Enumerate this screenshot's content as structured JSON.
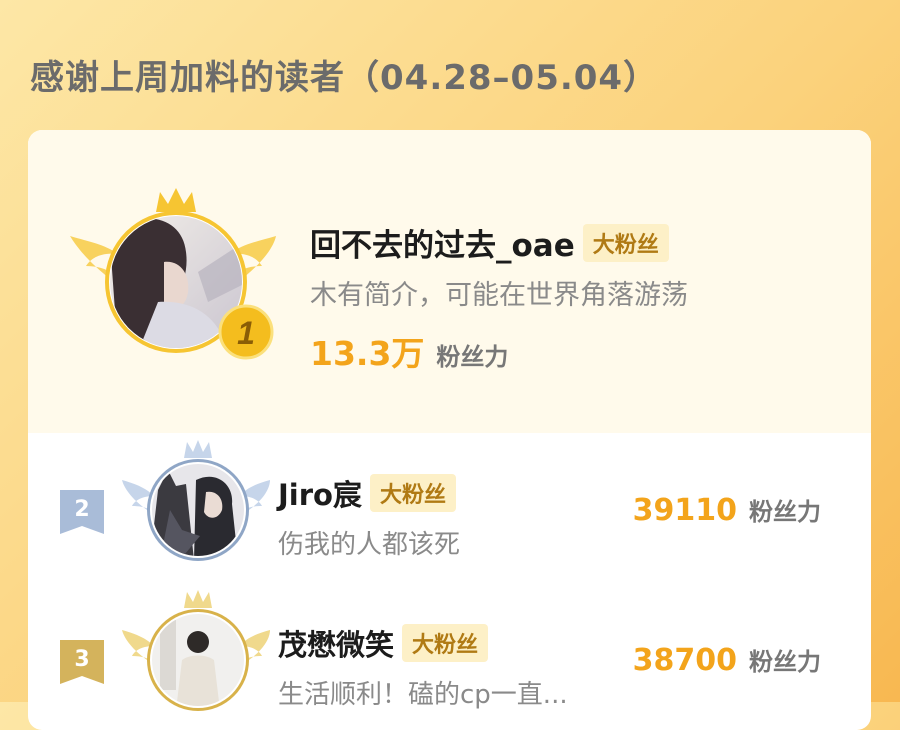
{
  "page": {
    "title": "感谢上周加料的读者（04.28–05.04）"
  },
  "fan_unit": "粉丝力",
  "ranking": [
    {
      "rank": "1",
      "name": "回不去的过去_oae",
      "tag": "大粉丝",
      "bio": "木有简介，可能在世界角落游荡",
      "fans": "13.3万",
      "frame_color": "#f6c532",
      "avatar_icon": "girl-portrait-avatar"
    },
    {
      "rank": "2",
      "name": "Jiro宸",
      "tag": "大粉丝",
      "bio": "伤我的人都该死",
      "fans": "39110",
      "frame_color": "#8fa6c6",
      "avatar_icon": "anime-pair-avatar"
    },
    {
      "rank": "3",
      "name": "茂懋微笑",
      "tag": "大粉丝",
      "bio": "生活顺利！磕的cp一直...",
      "fans": "38700",
      "frame_color": "#d8b24a",
      "avatar_icon": "person-photo-avatar"
    }
  ]
}
